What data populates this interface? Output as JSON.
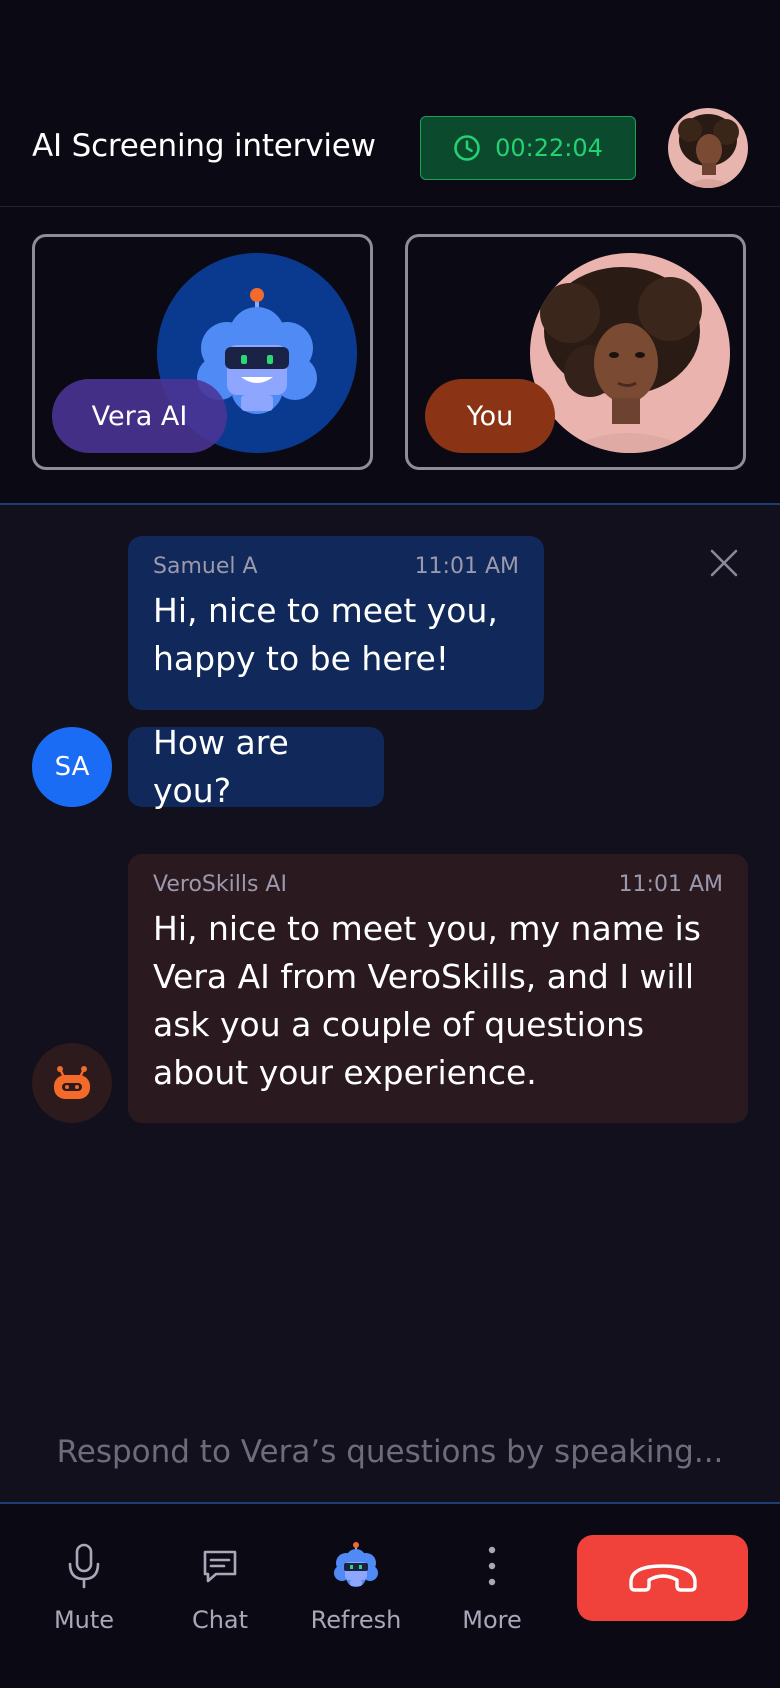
{
  "header": {
    "title": "AI Screening interview",
    "timer": "00:22:04",
    "timer_icon": "clock-icon",
    "avatar": "user-profile-photo"
  },
  "video": {
    "ai_tile": {
      "label": "Vera AI",
      "image": "robot-avatar"
    },
    "user_tile": {
      "label": "You",
      "image": "user-video-photo"
    }
  },
  "chat": {
    "close_icon": "close-icon",
    "messages": [
      {
        "sender": "Samuel A",
        "time": "11:01 AM",
        "text": "Hi, nice to meet you, happy to be here!"
      },
      {
        "text": "How are you?",
        "avatar_initials": "SA"
      },
      {
        "sender": "VeroSkills AI",
        "time": "11:01 AM",
        "text": "Hi, nice to meet you, my name is Vera AI from VeroSkills, and I will ask you a couple of questions about your experience.",
        "avatar_icon": "bot-icon"
      }
    ]
  },
  "hint": "Respond to Vera’s questions by speaking...",
  "toolbar": {
    "actions": [
      {
        "label": "Mute",
        "icon": "microphone-icon"
      },
      {
        "label": "Chat",
        "icon": "chat-icon"
      },
      {
        "label": "Refresh",
        "icon": "robot-icon"
      },
      {
        "label": "More",
        "icon": "more-vertical-icon"
      }
    ],
    "hangup_icon": "phone-hangup-icon"
  },
  "colors": {
    "background": "#0b0a14",
    "chat_background": "#12101c",
    "timer_text": "#23d273",
    "user_bubble": "#10285a",
    "ai_bubble": "#2a1a20",
    "avatar_blue": "#1a6cf5",
    "hangup_red": "#f0413a",
    "ai_pill": "#4c3496",
    "user_pill": "#8a3415"
  }
}
